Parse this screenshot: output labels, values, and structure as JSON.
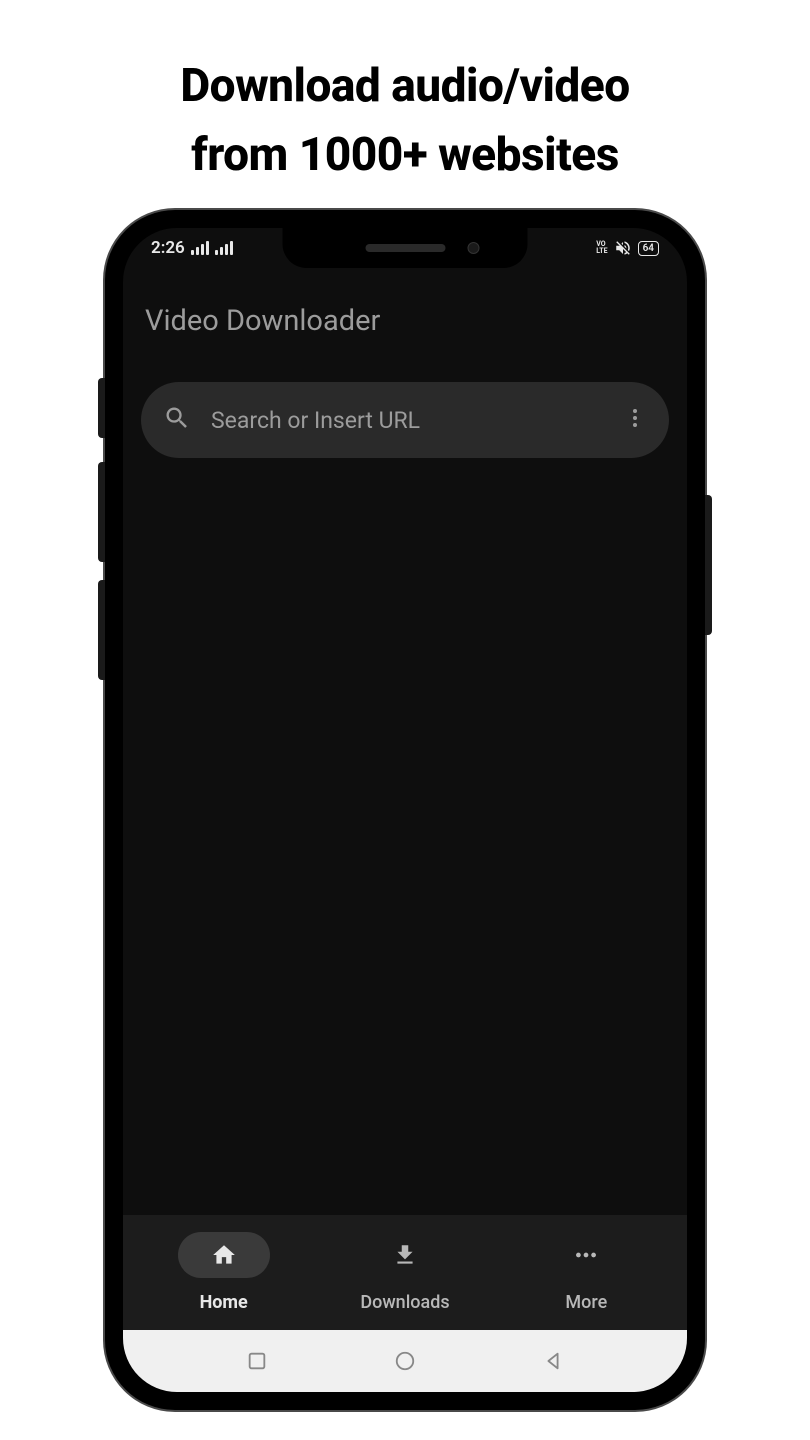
{
  "marketing": {
    "headline_line1": "Download audio/video",
    "headline_line2": "from 1000+ websites"
  },
  "status_bar": {
    "time": "2:26",
    "volte": "VO\nLTE",
    "battery": "64"
  },
  "app": {
    "title": "Video Downloader"
  },
  "search": {
    "placeholder": "Search or Insert URL"
  },
  "bottom_nav": {
    "items": [
      {
        "label": "Home",
        "active": true
      },
      {
        "label": "Downloads",
        "active": false
      },
      {
        "label": "More",
        "active": false
      }
    ]
  }
}
